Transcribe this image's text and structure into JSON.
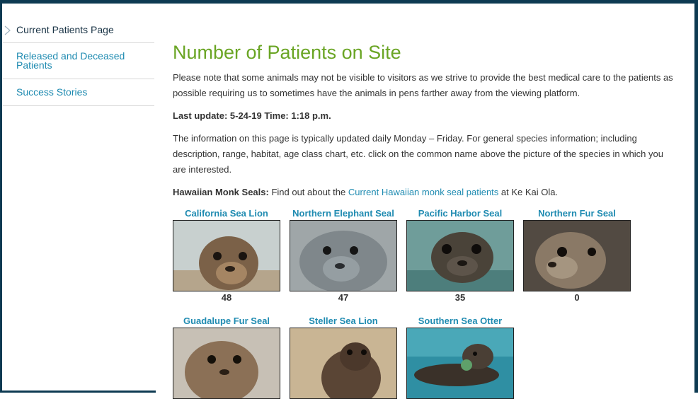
{
  "sidebar": {
    "items": [
      {
        "label": "Current Patients Page"
      },
      {
        "label": "Released and Deceased Patients"
      },
      {
        "label": "Success Stories"
      }
    ]
  },
  "main": {
    "title": "Number of Patients on Site",
    "note": "Please note that some animals may not be visible to visitors as we strive to provide the best medical care to the patients as possible requiring us to sometimes have the animals in pens farther away from the viewing platform.",
    "last_update_label": "Last update: 5-24-19 Time: 1:18 p.m.",
    "info": "The information on this page is typically updated daily Monday – Friday. For general species information; including description, range, habitat, age class chart, etc. click on the common name above the picture of the species in which you are interested.",
    "monk_label": "Hawaiian Monk Seals:",
    "monk_pre": " Find out about the ",
    "monk_link": "Current Hawaiian monk seal patients",
    "monk_post": " at Ke Kai Ola."
  },
  "species": [
    {
      "name": "California Sea Lion",
      "count": "48"
    },
    {
      "name": "Northern Elephant Seal",
      "count": "47"
    },
    {
      "name": "Pacific Harbor Seal",
      "count": "35"
    },
    {
      "name": "Northern Fur Seal",
      "count": "0"
    },
    {
      "name": "Guadalupe Fur Seal",
      "count": ""
    },
    {
      "name": "Steller Sea Lion",
      "count": ""
    },
    {
      "name": "Southern Sea Otter",
      "count": ""
    }
  ]
}
